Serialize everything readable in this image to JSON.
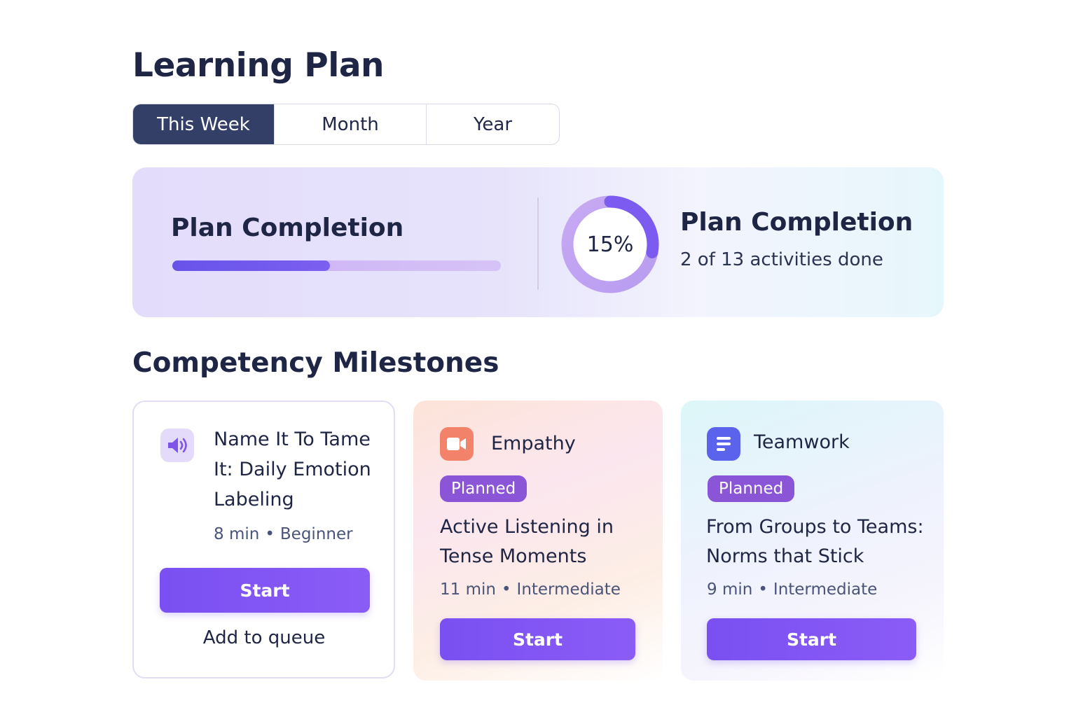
{
  "page": {
    "title": "Learning Plan"
  },
  "tabs": [
    {
      "label": "This Week",
      "active": true
    },
    {
      "label": "Month",
      "active": false
    },
    {
      "label": "Year",
      "active": false
    }
  ],
  "completion": {
    "left_title": "Plan Completion",
    "progress_fraction": 0.48,
    "percent_label": "15%",
    "ring_fraction": 0.15,
    "right_title": "Plan Completion",
    "subtitle": "2 of 13 activities done"
  },
  "milestones": {
    "title": "Competency Milestones",
    "cards": [
      {
        "icon": "speaker-icon",
        "title_lines": [
          "Name It To Tame",
          "It: Daily Emotion",
          "Labeling"
        ],
        "duration": "8 min",
        "separator": "•",
        "level": "Beginner",
        "button": "Start",
        "secondary": "Add to queue"
      },
      {
        "icon": "video-camera-icon",
        "category": "Empathy",
        "badge": "Planned",
        "title_lines": [
          "Active Listening in",
          "Tense Moments"
        ],
        "duration": "11 min",
        "separator": "•",
        "level": "Intermediate",
        "button": "Start"
      },
      {
        "icon": "document-list-icon",
        "category": "Teamwork",
        "badge": "Planned",
        "title_lines": [
          "From Groups to Teams:",
          "Norms that Stick"
        ],
        "duration": "9 min",
        "separator": "•",
        "level": "Intermediate",
        "button": "Start"
      }
    ]
  },
  "colors": {
    "accent": "#7c52f0",
    "navy": "#343f68",
    "badge": "#8b55d8",
    "empathy_icon": "#f2826a",
    "teamwork_icon": "#5b63ec"
  }
}
